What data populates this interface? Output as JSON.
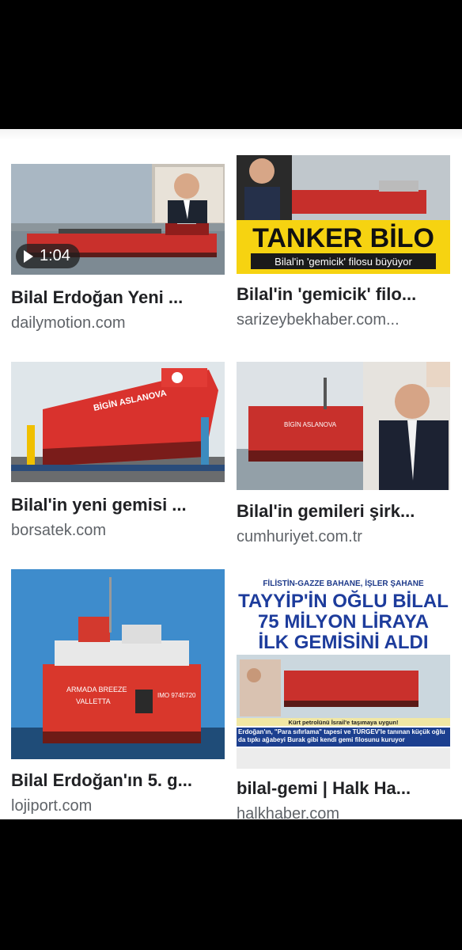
{
  "results": [
    {
      "title": "Bilal Erdoğan Yeni ...",
      "source": "dailymotion.com",
      "duration": "1:04"
    },
    {
      "title": "Bilal'in 'gemicik' filo...",
      "source": "sarizeybekhaber.com...",
      "headline": "TANKER BİLO",
      "subhead": "Bilal'in 'gemicik' filosu büyüyor"
    },
    {
      "title": "Bilal'in yeni gemisi ...",
      "source": "borsatek.com",
      "ship_name": "BİGİN ASLANOVA"
    },
    {
      "title": "Bilal'in gemileri şirk...",
      "source": "cumhuriyet.com.tr",
      "ship_name": "BİGİN ASLANOVA"
    },
    {
      "title": "Bilal Erdoğan'ın 5. g...",
      "source": "lojiport.com",
      "ship_text": "ARMADA BREEZE",
      "ship_port": "VALLETTA",
      "ship_imo": "IMO 9745720"
    },
    {
      "title": "bilal-gemi | Halk Ha...",
      "source": "halkhaber.com",
      "np_top": "FİLİSTİN-GAZZE BAHANE, İŞLER ŞAHANE",
      "np_line1": "TAYYİP'İN OĞLU BİLAL",
      "np_line2": "75 MİLYON LİRAYA",
      "np_line3": "İLK GEMİSİNİ ALDI",
      "np_caption": "Kürt petrolünü İsrail'e taşımaya uygun!",
      "np_body": "Erdoğan'ın, \"Para sıfırlama\" tapesi ve TÜRGEV'le tanınan küçük oğlu da tıpkı ağabeyi Burak gibi kendi gemi filosunu kuruyor"
    }
  ]
}
